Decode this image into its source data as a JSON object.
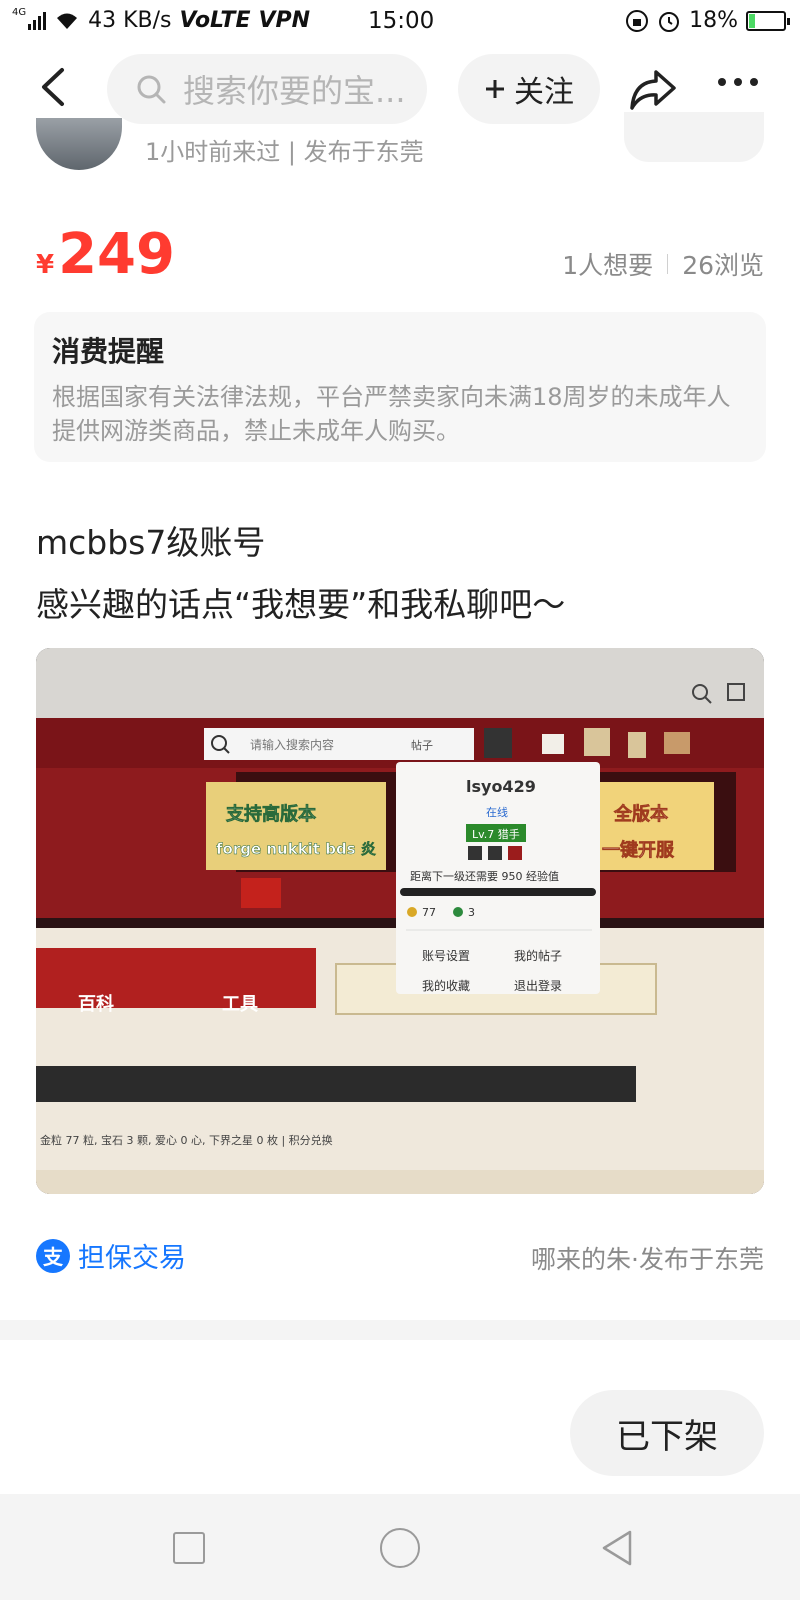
{
  "status_bar": {
    "network_tag": "4G",
    "speed": "43 KB/s",
    "volte": "VoLTE",
    "vpn": "VPN",
    "time": "15:00",
    "battery": "18%",
    "battery_level": 0.18
  },
  "nav": {
    "search_placeholder": "搜索你要的宝...",
    "follow_label": "关注"
  },
  "seller": {
    "meta": "1小时前来过 | 发布于东莞"
  },
  "price": {
    "currency": "¥",
    "amount": "249"
  },
  "stats": {
    "wants": "1人想要",
    "views": "26浏览"
  },
  "reminder": {
    "title": "消费提醒",
    "body": "根据国家有关法律法规，平台严禁卖家向未满18周岁的未成年人提供网游类商品，禁止未成年人购买。"
  },
  "description": {
    "line1": "mcbbs7级账号",
    "line2": "感兴趣的话点“我想要”和我私聊吧～"
  },
  "photo": {
    "search_placeholder": "请输入搜索内容",
    "search_type": "帖子",
    "banner_left_1": "支持高版本",
    "banner_left_2": "forge nukkit bds 炎",
    "banner_right_1": "全版本",
    "banner_right_2": "一键开服",
    "popup_username": "lsyo429",
    "popup_status": "在线",
    "popup_level": "Lv.7 猎手",
    "popup_exp": "距离下一级还需要 950 经验值",
    "popup_gold": "77",
    "popup_gem": "3",
    "popup_menu": [
      "账号设置",
      "我的帖子",
      "我的收藏",
      "退出登录"
    ],
    "tab_wiki": "百科",
    "tab_tools": "工具",
    "bottom_line": "金粒 77 粒, 宝石 3 颗, 爱心 0 心, 下界之星 0 枚 | 积分兑换"
  },
  "footer": {
    "guarantee": "担保交易",
    "origin": "哪来的朱·发布于东莞"
  },
  "action": {
    "status_button": "已下架"
  },
  "colors": {
    "price_red": "#ff3b30",
    "link_blue": "#1677ff",
    "card_bg": "#f7f7f7"
  }
}
